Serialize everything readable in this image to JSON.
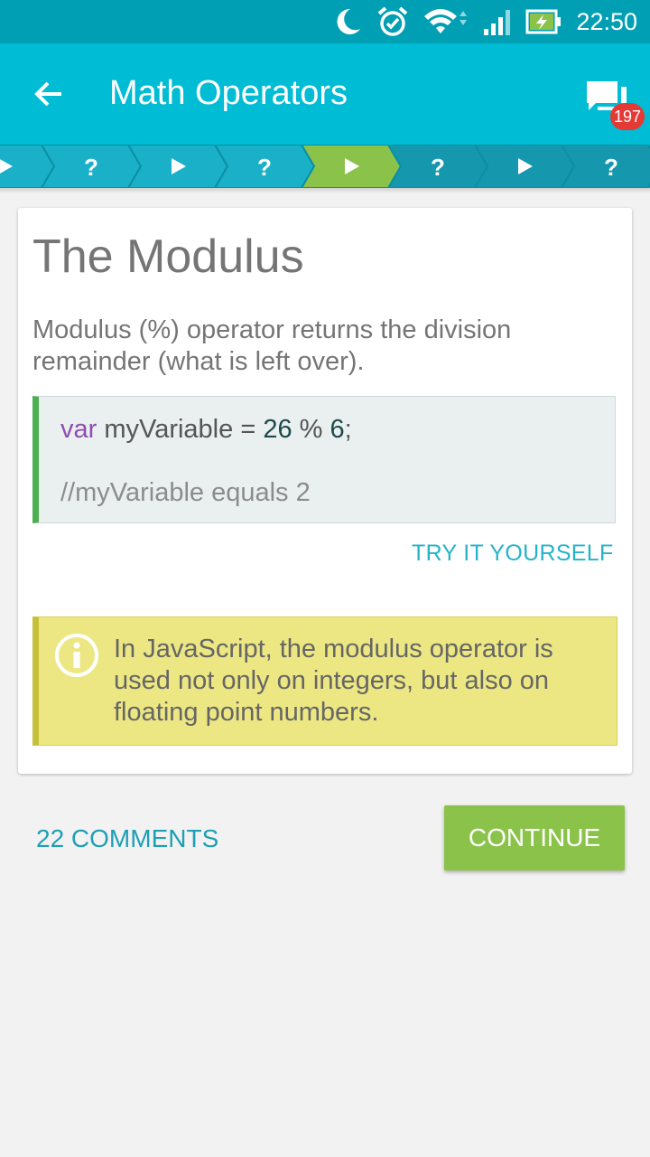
{
  "status_bar": {
    "time": "22:50",
    "icons": [
      "moon-icon",
      "alarm-icon",
      "wifi-icon",
      "signal-icon",
      "battery-charging-icon"
    ]
  },
  "app_bar": {
    "title": "Math Operators",
    "back_icon": "arrow-back-icon",
    "chat_icon": "chat-icon",
    "chat_badge": "197"
  },
  "progress": {
    "steps": [
      {
        "type": "lesson",
        "glyph": "▶"
      },
      {
        "type": "quiz",
        "glyph": "?"
      },
      {
        "type": "lesson",
        "glyph": "▶"
      },
      {
        "type": "quiz",
        "glyph": "?"
      },
      {
        "type": "lesson",
        "glyph": "▶",
        "current": true
      },
      {
        "type": "quiz",
        "glyph": "?"
      },
      {
        "type": "lesson",
        "glyph": "▶"
      },
      {
        "type": "quiz",
        "glyph": "?"
      }
    ],
    "colors": {
      "done": "#1ab0c8",
      "current": "#8bc34a",
      "upcoming": "#1597ad"
    }
  },
  "card": {
    "title": "The Modulus",
    "description": "Modulus (%) operator returns the division remainder (what is left over).",
    "code": {
      "keyword": "var",
      "variable": " myVariable = ",
      "num1": "26",
      "operator": " % ",
      "num2": "6",
      "end": ";",
      "comment": "//myVariable equals 2"
    },
    "try_label": "TRY IT YOURSELF",
    "note": {
      "icon": "info-icon",
      "text": "In JavaScript, the modulus operator is used not only on integers, but also on floating point numbers."
    }
  },
  "footer": {
    "comments_label": "22 COMMENTS",
    "continue_label": "CONTINUE"
  }
}
